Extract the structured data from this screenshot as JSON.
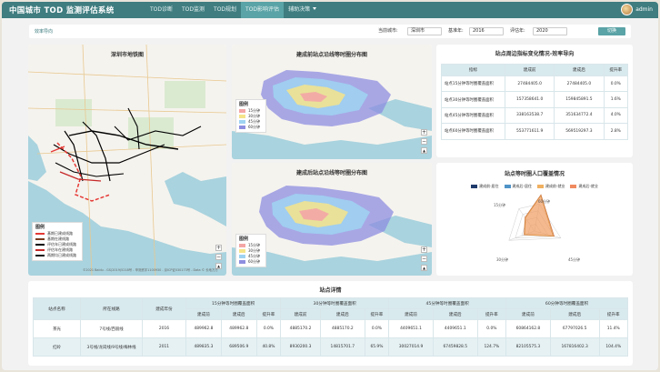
{
  "header": {
    "app_title": "中国城市 TOD 监测评估系统",
    "nav": [
      {
        "label": "TOD诊断"
      },
      {
        "label": "TOD监测"
      },
      {
        "label": "TOD规划"
      },
      {
        "label": "TOD影响评估"
      },
      {
        "label": "辅助决策"
      }
    ],
    "active_nav": "TOD影响评估",
    "user": "admin"
  },
  "filter_bar": {
    "section_title": "效率导向",
    "city_label": "当前城市:",
    "city_value": "深圳市",
    "base_year_label": "基准年:",
    "base_year_value": "2016",
    "eval_year_label": "评估年:",
    "eval_year_value": "2020",
    "switch_button": "切换"
  },
  "map_base": {
    "title": "深圳市地铁图",
    "legend_title": "图例",
    "legend_items": [
      "基期已建成线路",
      "基期在建线路",
      "评估年已建成线路",
      "评估年在建线路",
      "两期均已建成线路"
    ],
    "legend_colors": [
      "#e53935",
      "#7a3b1e",
      "#000000",
      "#c62828",
      "#111111"
    ],
    "zoom_in": "+",
    "zoom_out": "−",
    "compass": "▲",
    "attribution": "©2021 Baidu - GS(2019)5218号 - 甲测资字1100930 - 京ICP证030173号 - Data © 长地万方"
  },
  "map_before": {
    "title": "建成前站点沿线等时圈分布图",
    "legend_title": "图例",
    "legend_items": [
      "15分钟",
      "30分钟",
      "45分钟",
      "60分钟"
    ],
    "legend_colors": [
      "#f4a6a6",
      "#f6e48a",
      "#9fd3f2",
      "#8e8ee0"
    ],
    "zoom_in": "+",
    "zoom_out": "−",
    "compass": "▲"
  },
  "map_after": {
    "title": "建成后站点沿线等时圈分布图",
    "legend_title": "图例",
    "legend_items": [
      "15分钟",
      "30分钟",
      "45分钟",
      "60分钟"
    ],
    "legend_colors": [
      "#f4a6a6",
      "#f6e48a",
      "#9fd3f2",
      "#8e8ee0"
    ],
    "zoom_in": "+",
    "zoom_out": "−",
    "compass": "▲"
  },
  "efficiency_table": {
    "title": "站点周边指标变化情况-效率导向",
    "columns": [
      "指标",
      "建成前",
      "建成后",
      "提升率"
    ],
    "rows": [
      [
        "站点15分钟等时圈覆盖面积",
        "27484405.0",
        "27484405.0",
        "0.0%"
      ],
      [
        "站点30分钟等时圈覆盖面积",
        "157358641.0",
        "159845891.5",
        "1.6%"
      ],
      [
        "站点45分钟等时圈覆盖面积",
        "338163538.7",
        "351634772.4",
        "4.0%"
      ],
      [
        "站点60分钟等时圈覆盖面积",
        "553771611.9",
        "569519297.3",
        "2.8%"
      ]
    ]
  },
  "radar": {
    "title": "站点等时圈人口覆盖情况",
    "legend": [
      "建成前-居住",
      "建成后-居住",
      "建成前-就业",
      "建成后-就业"
    ],
    "legend_colors": [
      "#1f3b6b",
      "#4f93c7",
      "#f0b060",
      "#f08a60"
    ],
    "axes": [
      "60分钟",
      "45分钟",
      "30分钟",
      "15分钟"
    ],
    "chart_data": {
      "type": "radar",
      "axes": [
        "60分钟",
        "45分钟",
        "30分钟",
        "15分钟"
      ],
      "series": [
        {
          "name": "建成后-就业",
          "values": [
            1.0,
            0.55,
            0.3,
            0.45
          ]
        },
        {
          "name": "建成前-就业",
          "values": [
            0.97,
            0.52,
            0.28,
            0.43
          ]
        }
      ]
    }
  },
  "detail_table": {
    "title": "站点详情",
    "col_station": "站点名称",
    "col_line": "所在线路",
    "col_year": "建成年份",
    "groups": [
      "15分钟等时圈覆盖面积",
      "30分钟等时圈覆盖面积",
      "45分钟等时圈覆盖面积",
      "60分钟等时圈覆盖面积"
    ],
    "sub": [
      "建成前",
      "建成后",
      "提升率"
    ],
    "rows": [
      [
        "茶光",
        "7号线/西丽线",
        "2016",
        "489962.8",
        "489962.8",
        "0.0%",
        "4885170.2",
        "4885170.2",
        "0.0%",
        "4409651.1",
        "4409651.1",
        "0.0%",
        "60864162.8",
        "67797026.5",
        "11.4%"
      ],
      [
        "红岭",
        "3号线/龙岗线/9号线/梅林线",
        "2011",
        "489835.3",
        "689506.9",
        "40.8%",
        "8930200.3",
        "14815701.7",
        "65.9%",
        "30027014.9",
        "67459828.5",
        "124.7%",
        "82105575.3",
        "167816402.3",
        "104.4%"
      ]
    ]
  }
}
